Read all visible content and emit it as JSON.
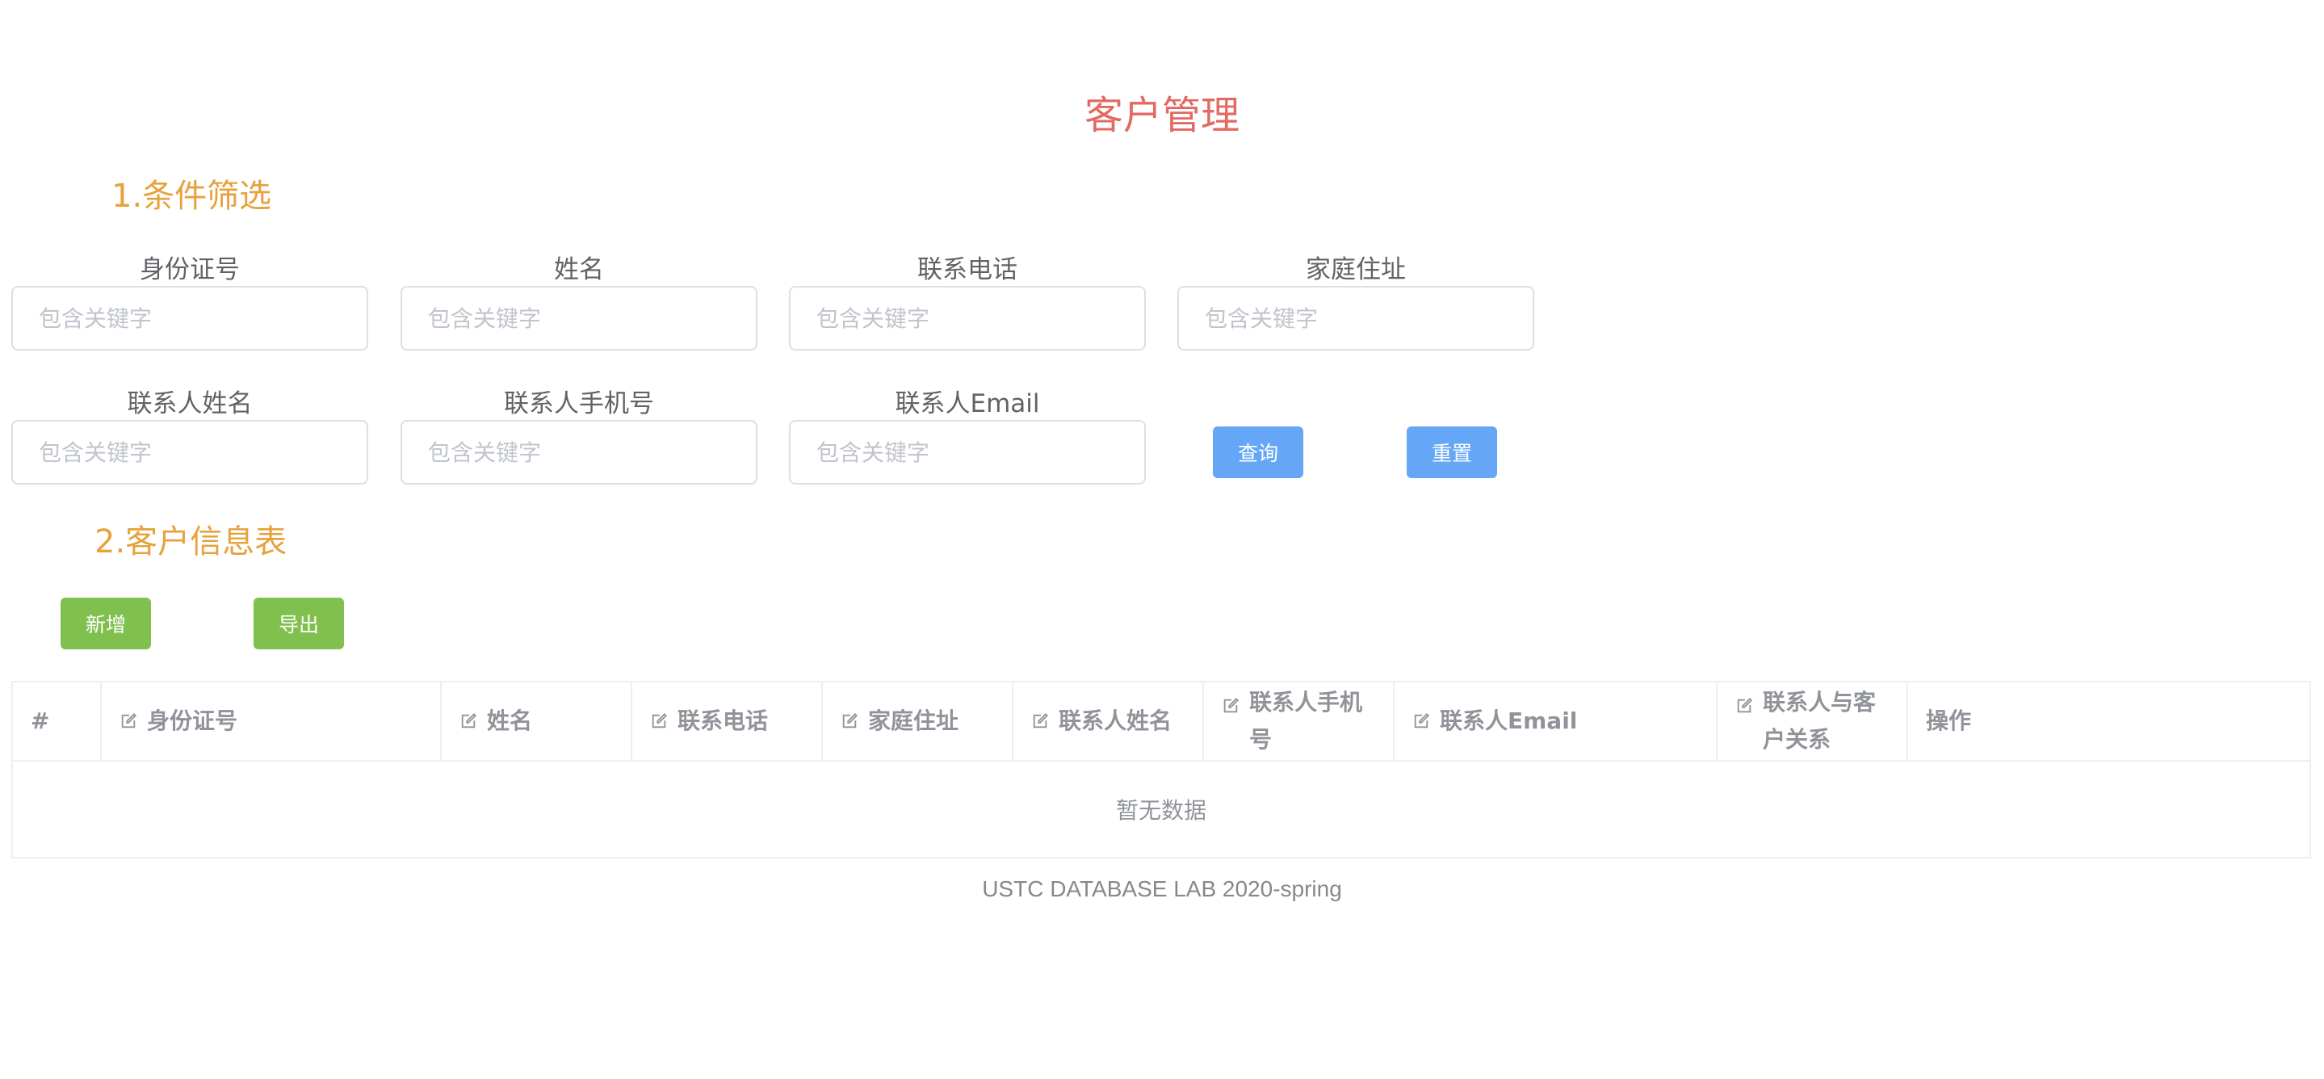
{
  "page_title": "客户管理",
  "filter_section": {
    "title": "1.条件筛选",
    "fields": [
      {
        "label": "身份证号",
        "placeholder": "包含关键字",
        "value": ""
      },
      {
        "label": "姓名",
        "placeholder": "包含关键字",
        "value": ""
      },
      {
        "label": "联系电话",
        "placeholder": "包含关键字",
        "value": ""
      },
      {
        "label": "家庭住址",
        "placeholder": "包含关键字",
        "value": ""
      },
      {
        "label": "联系人姓名",
        "placeholder": "包含关键字",
        "value": ""
      },
      {
        "label": "联系人手机号",
        "placeholder": "包含关键字",
        "value": ""
      },
      {
        "label": "联系人Email",
        "placeholder": "包含关键字",
        "value": ""
      }
    ],
    "query_button": "查询",
    "reset_button": "重置"
  },
  "table_section": {
    "title": "2.客户信息表",
    "add_button": "新增",
    "export_button": "导出",
    "columns": [
      {
        "label": "#"
      },
      {
        "label": "身份证号"
      },
      {
        "label": "姓名"
      },
      {
        "label": "联系电话"
      },
      {
        "label": "家庭住址"
      },
      {
        "label": "联系人姓名"
      },
      {
        "label": "联系人手机号"
      },
      {
        "label": "联系人Email"
      },
      {
        "label": "联系人与客户关系"
      },
      {
        "label": "操作"
      }
    ],
    "empty_text": "暂无数据"
  },
  "footer": "USTC DATABASE LAB 2020-spring",
  "colors": {
    "title": "#e26a64",
    "section": "#e6a23c",
    "primary": "#66a6f6",
    "success": "#7fc04e"
  }
}
